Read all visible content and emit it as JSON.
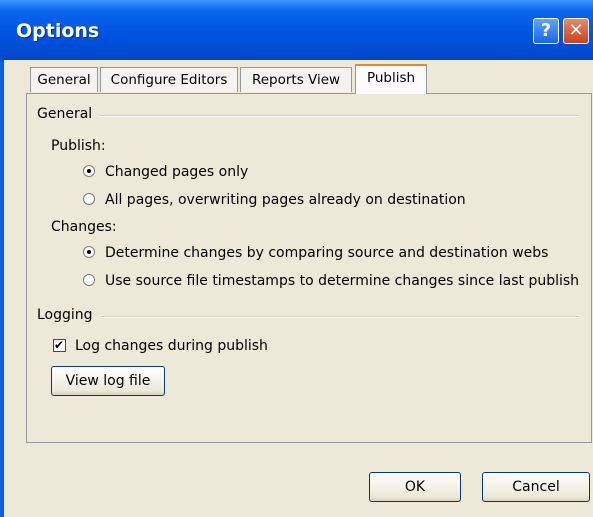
{
  "window": {
    "title": "Options",
    "help_glyph": "?",
    "close_glyph": "✕"
  },
  "tabs": [
    {
      "label": "General"
    },
    {
      "label": "Configure Editors"
    },
    {
      "label": "Reports View"
    },
    {
      "label": "Publish",
      "active": true
    }
  ],
  "general_group": {
    "title": "General",
    "publish_label": "Publish:",
    "publish_options": [
      {
        "label": "Changed pages only",
        "selected": true
      },
      {
        "label": "All pages, overwriting pages already on destination",
        "selected": false
      }
    ],
    "changes_label": "Changes:",
    "changes_options": [
      {
        "label": "Determine changes by comparing source and destination webs",
        "selected": true
      },
      {
        "label": "Use source file timestamps to determine changes since last publish",
        "selected": false
      }
    ]
  },
  "logging_group": {
    "title": "Logging",
    "log_checkbox_label": "Log changes during publish",
    "log_checked": true,
    "view_log_button": "View log file"
  },
  "footer": {
    "ok_label": "OK",
    "cancel_label": "Cancel"
  },
  "colors": {
    "titlebar": "#0054e3",
    "dialog_bg": "#ece9d8",
    "tab_accent": "#e68b2c"
  }
}
